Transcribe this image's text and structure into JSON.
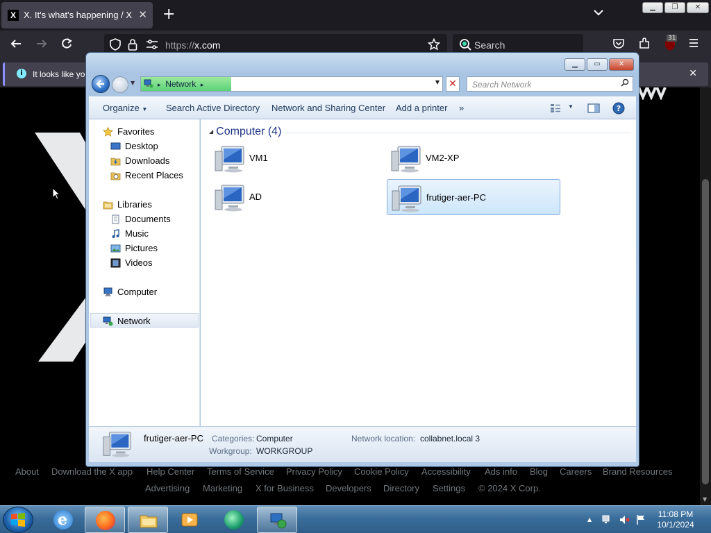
{
  "browser": {
    "tab_title": "X. It's what's happening / X",
    "tab_close": "✕",
    "new_tab": "+",
    "tab_list": "⌄",
    "url_scheme": "https://",
    "url_host": "x.com",
    "search_label": "Search",
    "notification_badge": "31",
    "notice_text": "It looks like you",
    "notice_close": "✕"
  },
  "x_page": {
    "footer_links": [
      "About",
      "Download the X app",
      "Help Center",
      "Terms of Service",
      "Privacy Policy",
      "Cookie Policy",
      "Accessibility",
      "Ads info",
      "Blog",
      "Careers",
      "Brand Resources",
      "Advertising",
      "Marketing",
      "X for Business",
      "Developers",
      "Directory",
      "Settings",
      "© 2024 X Corp."
    ]
  },
  "explorer": {
    "address": {
      "crumb": "Network",
      "separator": "▸"
    },
    "search_placeholder": "Search Network",
    "commands": {
      "organize": "Organize",
      "search_ad": "Search Active Directory",
      "nsc": "Network and Sharing Center",
      "add_printer": "Add a printer",
      "more": "»"
    },
    "nav": {
      "favorites": "Favorites",
      "desktop": "Desktop",
      "downloads": "Downloads",
      "recent": "Recent Places",
      "libraries": "Libraries",
      "documents": "Documents",
      "music": "Music",
      "pictures": "Pictures",
      "videos": "Videos",
      "computer": "Computer",
      "network": "Network"
    },
    "group_header": "Computer (4)",
    "items": [
      "VM1",
      "VM2-XP",
      "AD",
      "frutiger-aer-PC"
    ],
    "details": {
      "name": "frutiger-aer-PC",
      "categories_label": "Categories:",
      "categories_value": "Computer",
      "workgroup_label": "Workgroup:",
      "workgroup_value": "WORKGROUP",
      "netloc_label": "Network location:",
      "netloc_value": "collabnet.local  3"
    }
  },
  "taskbar": {
    "time": "11:08 PM",
    "date": "10/1/2024"
  },
  "colors": {
    "explorer_accent": "#1e3287",
    "selection": "#cde6fb",
    "taskbar": "#3a6d9a"
  }
}
